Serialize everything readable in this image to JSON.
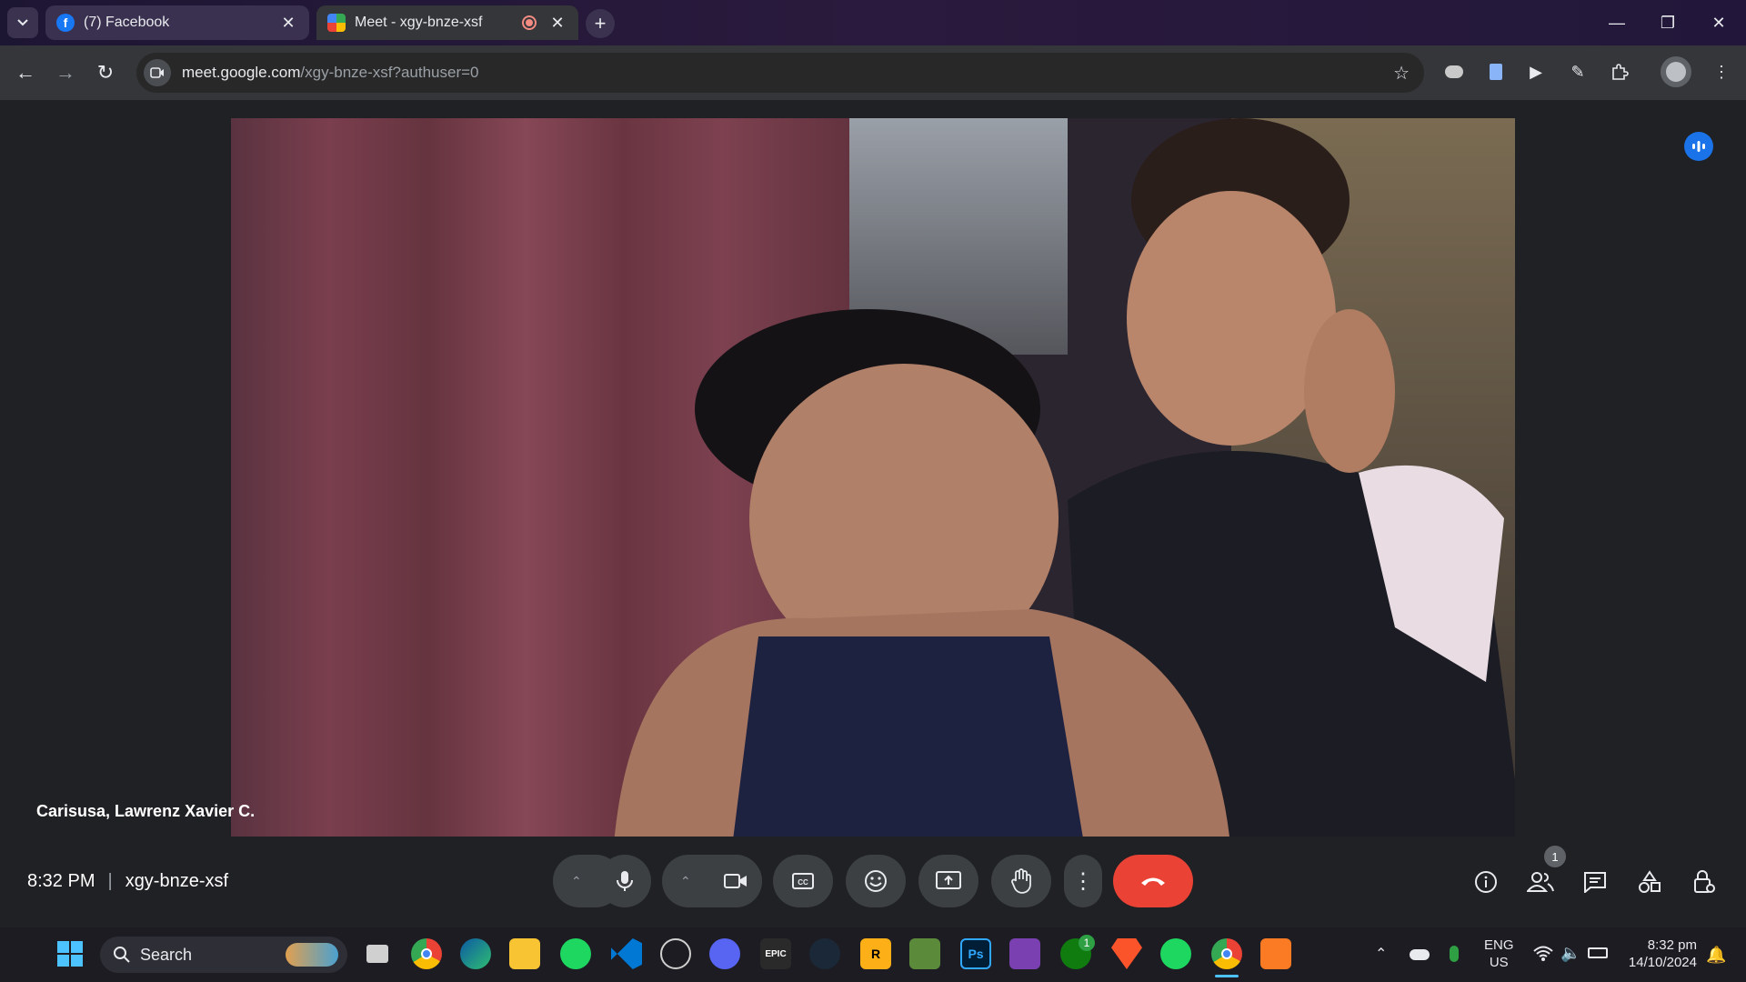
{
  "browser": {
    "tabs": [
      {
        "title": "(7) Facebook",
        "close": "✕"
      },
      {
        "title": "Meet - xgy-bnze-xsf",
        "close": "✕"
      }
    ],
    "new_tab": "+",
    "url_host": "meet.google.com",
    "url_path": "/xgy-bnze-xsf?authuser=0"
  },
  "meet": {
    "participant_name": "Carisusa, Lawrenz Xavier C.",
    "time": "8:32 PM",
    "separator": "|",
    "meeting_code": "xgy-bnze-xsf",
    "people_count": "1"
  },
  "taskbar": {
    "search_placeholder": "Search",
    "lang_top": "ENG",
    "lang_bottom": "US",
    "clock_time": "8:32 pm",
    "clock_date": "14/10/2024",
    "xbox_badge": "1",
    "epic_label": "EPIC",
    "ps_label": "Ps"
  },
  "colors": {
    "end_call": "#ea4335",
    "accent": "#1a73e8",
    "control_bg": "#3c4043"
  }
}
